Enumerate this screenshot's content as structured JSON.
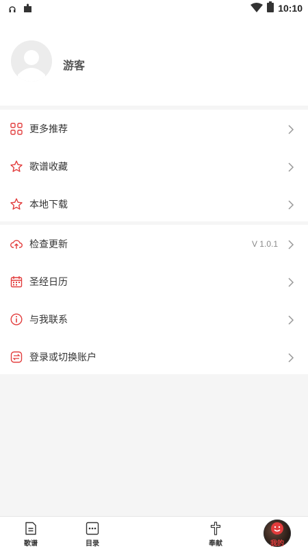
{
  "status": {
    "time": "10:10",
    "left_icons": [
      "headphones-icon",
      "puzzle-icon"
    ],
    "right_icons": [
      "wifi-icon",
      "battery-icon"
    ]
  },
  "profile": {
    "username": "游客"
  },
  "menu_group_1": [
    {
      "label": "更多推荐",
      "icon": "grid-icon"
    },
    {
      "label": "歌谱收藏",
      "icon": "star-icon"
    },
    {
      "label": "本地下载",
      "icon": "star-icon"
    }
  ],
  "menu_group_2": [
    {
      "label": "检查更新",
      "icon": "cloud-upload-icon",
      "value": "V 1.0.1"
    },
    {
      "label": "圣经日历",
      "icon": "calendar-icon"
    },
    {
      "label": "与我联系",
      "icon": "info-icon"
    },
    {
      "label": "登录或切换账户",
      "icon": "switch-icon"
    }
  ],
  "tabbar": {
    "tabs": [
      {
        "label": "歌谱",
        "icon": "document-icon",
        "active": false
      },
      {
        "label": "目录",
        "icon": "more-icon",
        "active": false
      },
      {
        "label": "",
        "icon": "music-disc-icon",
        "active": false
      },
      {
        "label": "奉献",
        "icon": "cross-icon",
        "active": false
      },
      {
        "label": "我的",
        "icon": "smiley-icon",
        "active": true
      }
    ]
  },
  "colors": {
    "accent": "#e23c3c",
    "background": "#f5f5f5",
    "card": "#ffffff"
  }
}
